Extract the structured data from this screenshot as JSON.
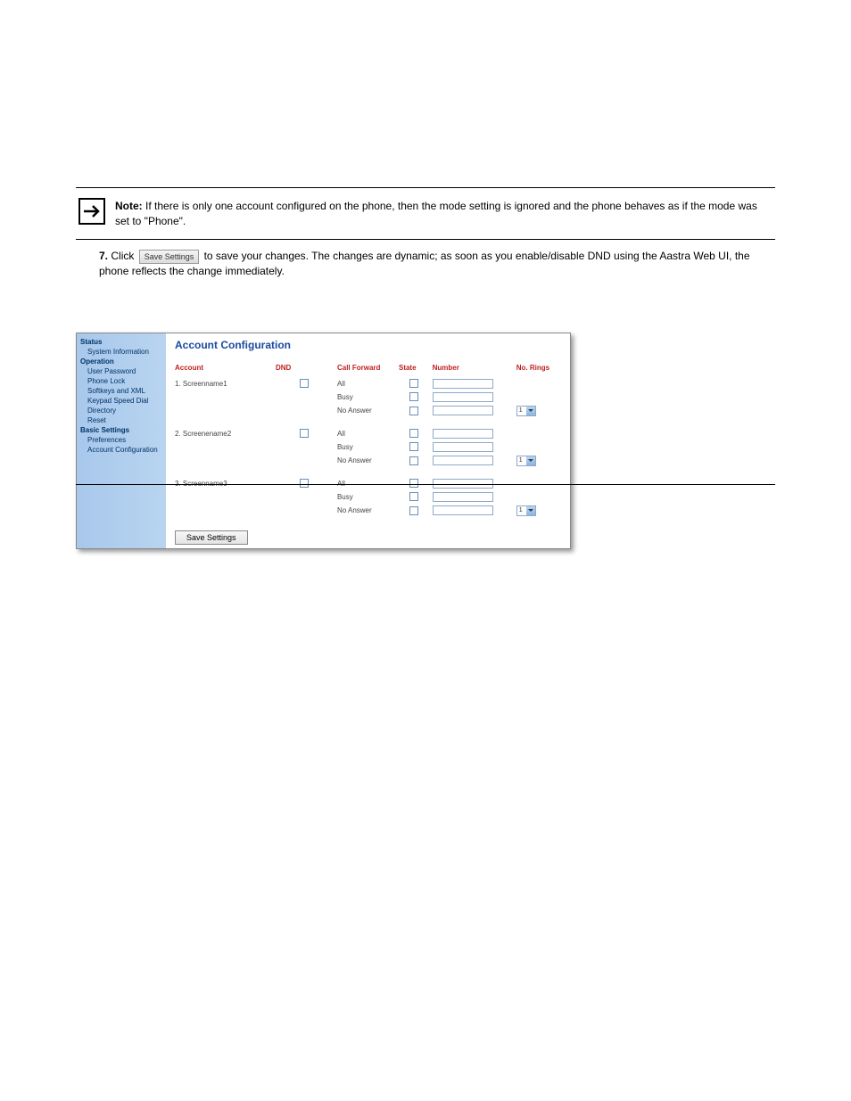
{
  "note": {
    "label": "Note:",
    "text1": "If there is only one account configured on the phone, then the mode setting is ignored and the phone behaves as if the mode was set to \"Phone\".",
    "button_label": "Save Settings",
    "text2": "Click            to save your changes. The changes are dynamic; as soon as you enable/disable DND using the Aastra Web UI, the phone reflects the change immediately.",
    "text2_prefix": "Click",
    "text2_suffix": "to save your changes. The changes are dynamic; as soon as you enable/disable DND using the Aastra Web UI, the phone reflects the change immediately."
  },
  "sidebar": {
    "headings": {
      "status": "Status",
      "operation": "Operation",
      "basic": "Basic Settings"
    },
    "items": {
      "system_info": "System Information",
      "user_password": "User Password",
      "phone_lock": "Phone Lock",
      "softkeys_xml": "Softkeys and XML",
      "keypad_speed": "Keypad Speed Dial",
      "directory": "Directory",
      "reset": "Reset",
      "preferences": "Preferences",
      "account_config": "Account Configuration"
    }
  },
  "panel": {
    "title": "Account Configuration",
    "headers": {
      "account": "Account",
      "dnd": "DND",
      "call_forward": "Call Forward",
      "state": "State",
      "number": "Number",
      "no_rings": "No. Rings"
    },
    "cf_modes": {
      "all": "All",
      "busy": "Busy",
      "no_answer": "No Answer"
    },
    "accounts": [
      {
        "label": "1. Screenname1",
        "rings": "1"
      },
      {
        "label": "2. Screenename2",
        "rings": "1"
      },
      {
        "label": "3. Screenname3",
        "rings": "1"
      }
    ],
    "save_label": "Save Settings"
  }
}
